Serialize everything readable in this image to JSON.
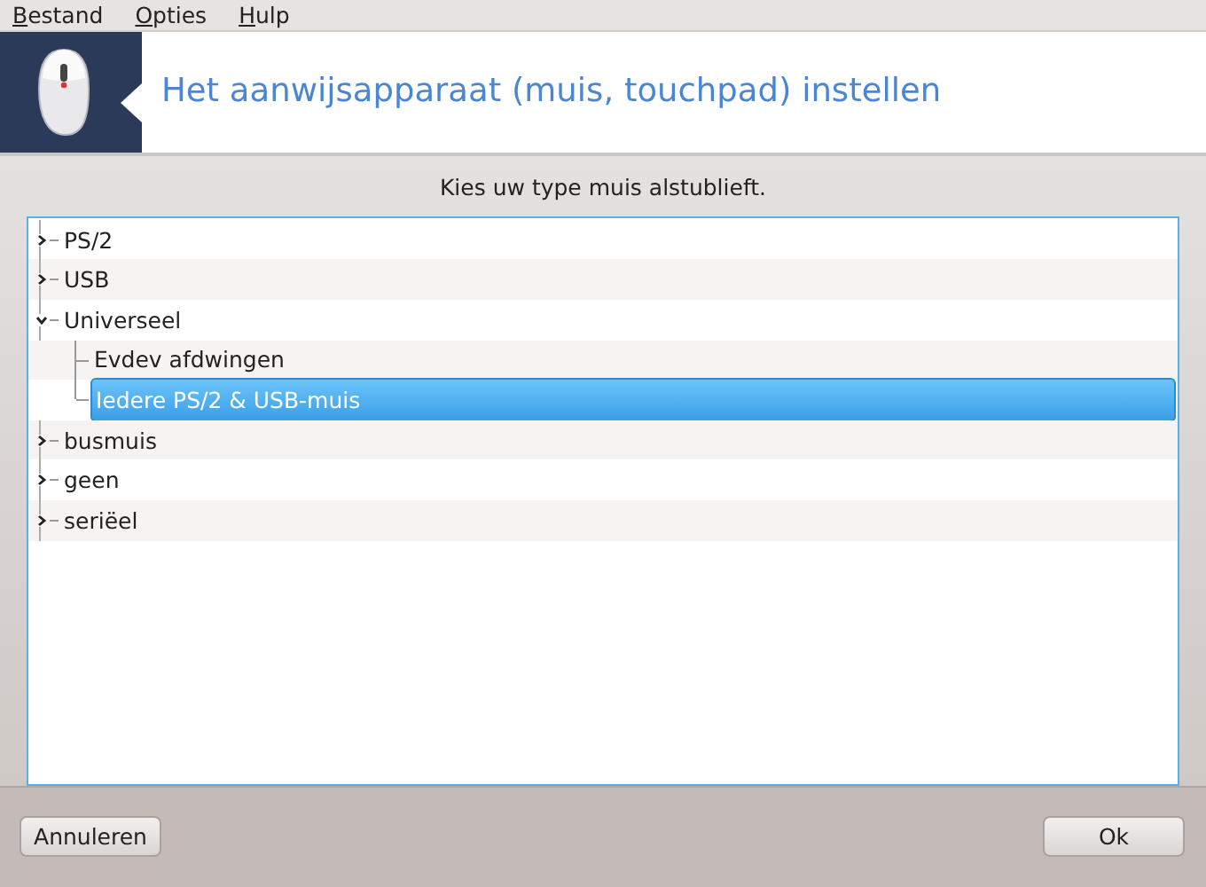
{
  "menu": [
    {
      "label": "Bestand"
    },
    {
      "label": "Opties"
    },
    {
      "label": "Hulp"
    }
  ],
  "header": {
    "title": "Het aanwijsapparaat (muis, touchpad) instellen"
  },
  "prompt": "Kies uw type muis alstublieft.",
  "tree": [
    {
      "label": "PS/2",
      "expanded": false,
      "selected": false
    },
    {
      "label": "USB",
      "expanded": false,
      "selected": false
    },
    {
      "label": "Universeel",
      "expanded": true,
      "selected": false,
      "children": [
        {
          "label": "Evdev afdwingen",
          "selected": false
        },
        {
          "label": "Iedere PS/2 & USB-muis",
          "selected": true
        }
      ]
    },
    {
      "label": "busmuis",
      "expanded": false,
      "selected": false
    },
    {
      "label": "geen",
      "expanded": false,
      "selected": false
    },
    {
      "label": "seriëel",
      "expanded": false,
      "selected": false
    }
  ],
  "buttons": [
    {
      "label": "Annuleren"
    },
    {
      "label": "Ok"
    }
  ]
}
